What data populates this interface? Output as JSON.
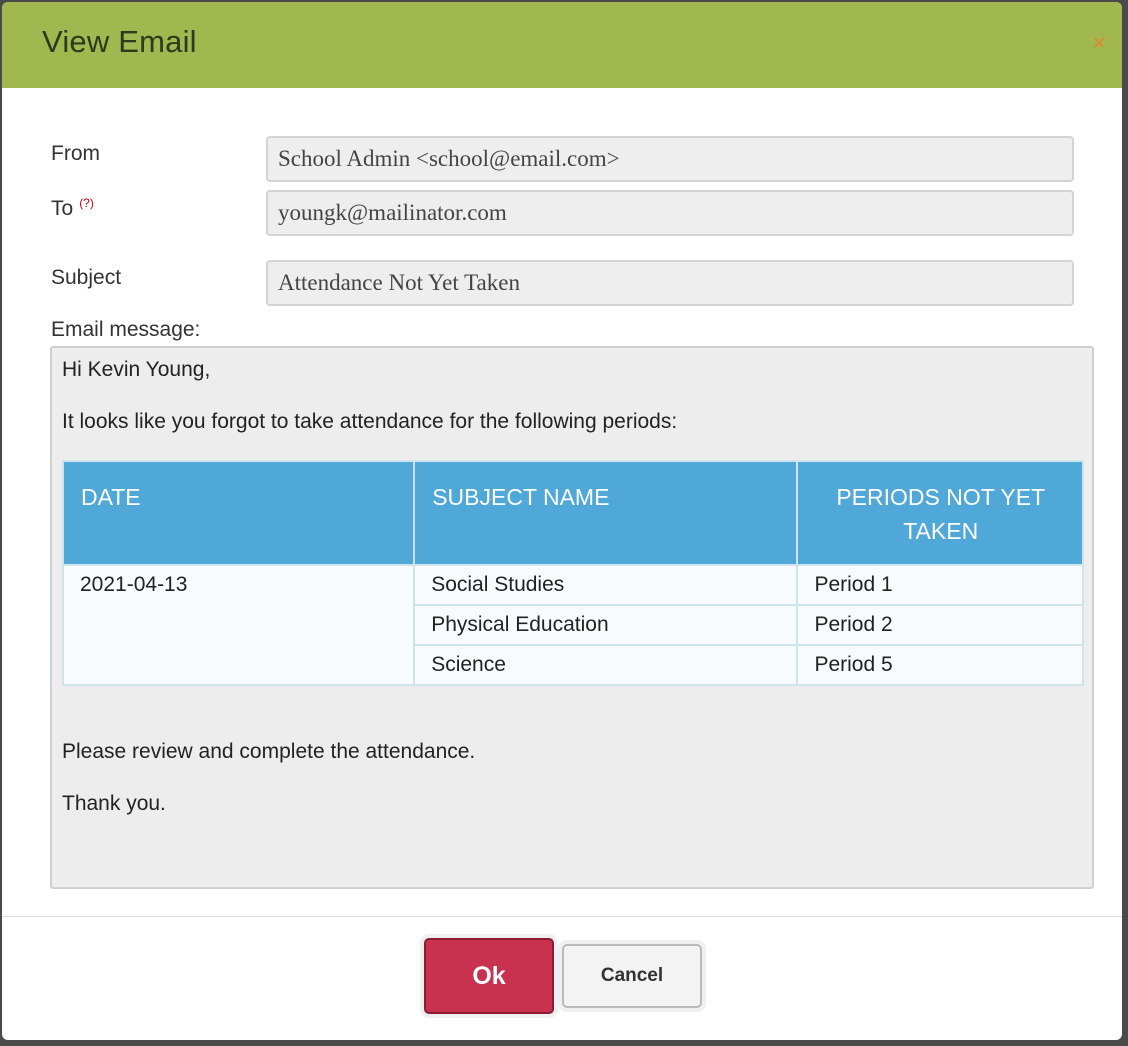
{
  "dialog": {
    "title": "View Email",
    "close_icon": "×"
  },
  "form": {
    "from_label": "From",
    "from_value": "School Admin <school@email.com>",
    "to_label": "To",
    "to_help": "(?)",
    "to_value": "youngk@mailinator.com",
    "subject_label": "Subject",
    "subject_value": "Attendance Not Yet Taken",
    "message_label": "Email message:"
  },
  "message": {
    "greeting": "Hi Kevin Young,",
    "intro": "It looks like you forgot to take attendance for the following periods:",
    "table": {
      "headers": [
        "DATE",
        "SUBJECT NAME",
        "PERIODS NOT YET TAKEN"
      ],
      "date": "2021-04-13",
      "rows": [
        {
          "subject": "Social Studies",
          "period": "Period 1"
        },
        {
          "subject": "Physical Education",
          "period": "Period 2"
        },
        {
          "subject": "Science",
          "period": "Period 5"
        }
      ]
    },
    "closing": "Please review and complete the attendance.",
    "signoff": "Thank you."
  },
  "buttons": {
    "ok": "Ok",
    "cancel": "Cancel"
  },
  "colors": {
    "header": "#a1b74f",
    "table_header": "#4fa8d8",
    "ok_button": "#c8324e",
    "close_icon": "#e8812a"
  }
}
